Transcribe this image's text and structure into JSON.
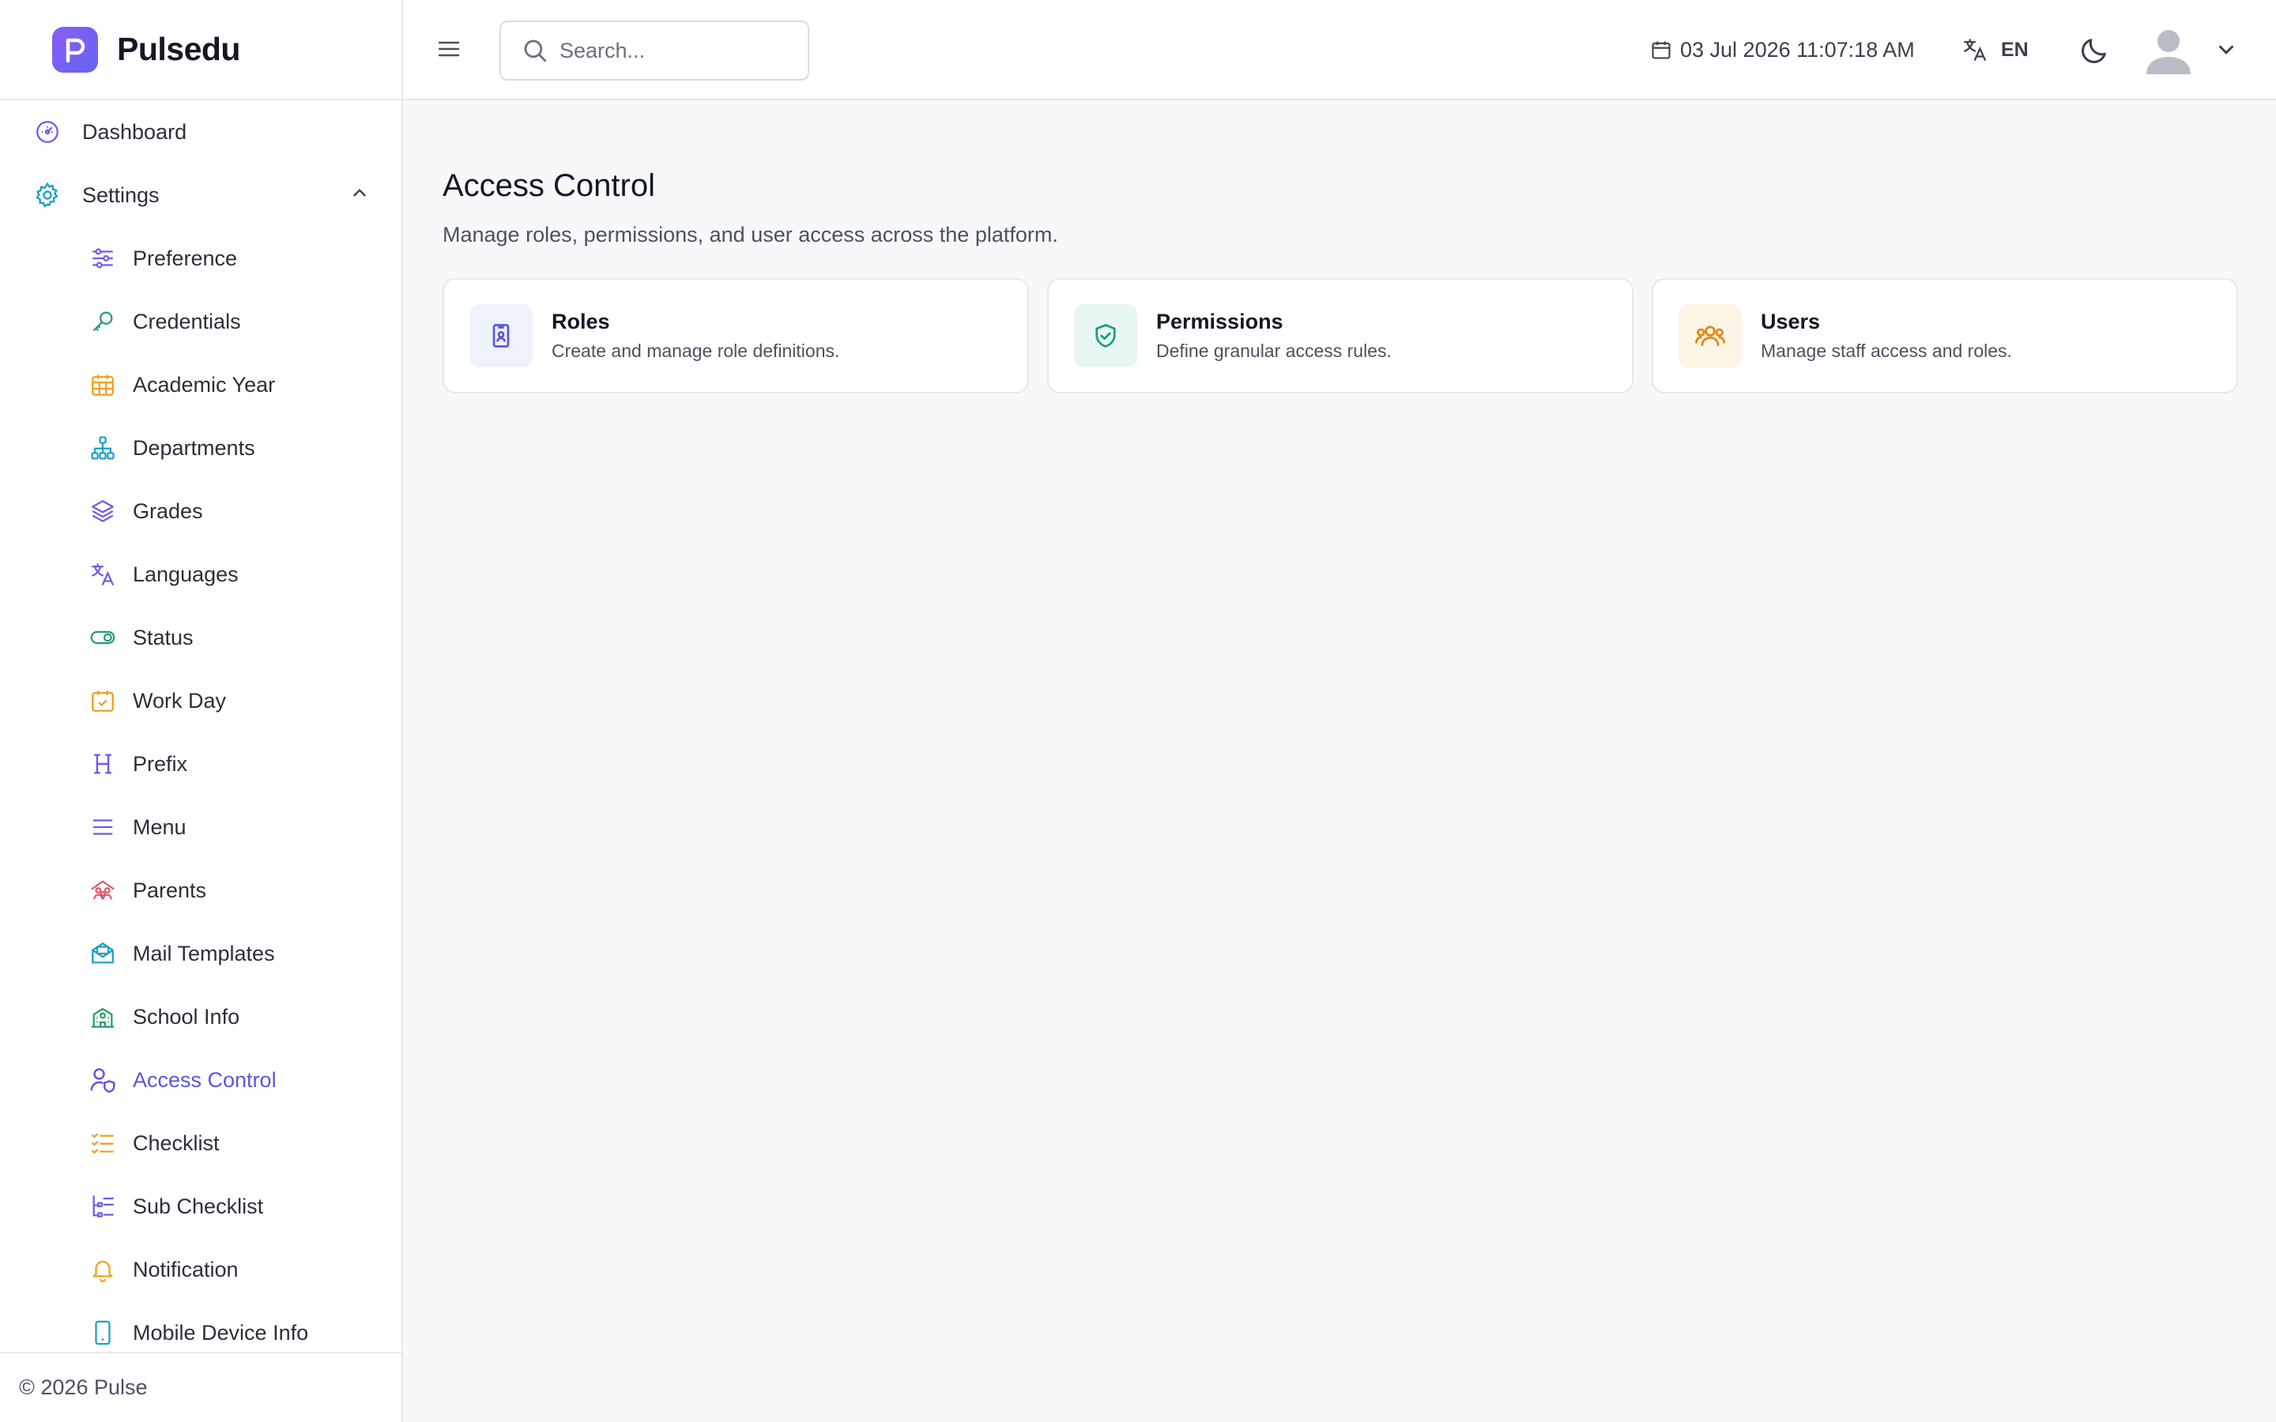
{
  "brand": {
    "name": "Pulsedu",
    "color": "#7c5cf0"
  },
  "sidebar": {
    "top_items": [
      {
        "label": "Dashboard",
        "icon": "gauge-icon",
        "color": "#6d5ce8"
      },
      {
        "label": "Settings",
        "icon": "gear-icon",
        "color": "#1ea0c8",
        "expanded": true
      }
    ],
    "sub_items": [
      {
        "label": "Preference",
        "icon": "sliders-icon",
        "color": "#6d5ce8"
      },
      {
        "label": "Credentials",
        "icon": "key-icon",
        "color": "#22a06b"
      },
      {
        "label": "Academic Year",
        "icon": "calendar-grid-icon",
        "color": "#f0a020"
      },
      {
        "label": "Departments",
        "icon": "hierarchy-icon",
        "color": "#1ea0c8"
      },
      {
        "label": "Grades",
        "icon": "layers-icon",
        "color": "#6d5ce8"
      },
      {
        "label": "Languages",
        "icon": "translate-icon",
        "color": "#6d5ce8"
      },
      {
        "label": "Status",
        "icon": "toggle-icon",
        "color": "#22a06b"
      },
      {
        "label": "Work Day",
        "icon": "calendar-check-icon",
        "color": "#f0a020"
      },
      {
        "label": "Prefix",
        "icon": "heading-icon",
        "color": "#6d5ce8"
      },
      {
        "label": "Menu",
        "icon": "menu-lines-icon",
        "color": "#6d5ce8"
      },
      {
        "label": "Parents",
        "icon": "family-icon",
        "color": "#e0506a"
      },
      {
        "label": "Mail Templates",
        "icon": "mail-template-icon",
        "color": "#1ea0c8"
      },
      {
        "label": "School Info",
        "icon": "school-icon",
        "color": "#22a06b"
      },
      {
        "label": "Access Control",
        "icon": "user-shield-icon",
        "color": "#5b55e0",
        "active": true
      },
      {
        "label": "Checklist",
        "icon": "checklist-icon",
        "color": "#f0a020"
      },
      {
        "label": "Sub Checklist",
        "icon": "sub-checklist-icon",
        "color": "#6d5ce8"
      },
      {
        "label": "Notification",
        "icon": "bell-icon",
        "color": "#f0a020"
      },
      {
        "label": "Mobile Device Info",
        "icon": "mobile-icon",
        "color": "#1ea0c8"
      }
    ],
    "footer": "© 2026 Pulse"
  },
  "header": {
    "search_placeholder": "Search...",
    "datetime": "03 Jul 2026 11:07:18 AM",
    "language": "EN"
  },
  "main": {
    "title": "Access Control",
    "subtitle": "Manage roles, permissions, and user access across the platform.",
    "cards": [
      {
        "title": "Roles",
        "desc": "Create and manage role definitions.",
        "icon": "id-badge-icon",
        "color": "#5b55e0",
        "tile_bg": "#eef2fb"
      },
      {
        "title": "Permissions",
        "desc": "Define granular access rules.",
        "icon": "shield-check-icon",
        "color": "#14a07a",
        "tile_bg": "#e8f6f3"
      },
      {
        "title": "Users",
        "desc": "Manage staff access and roles.",
        "icon": "users-icon",
        "color": "#e08a1a",
        "tile_bg": "#fdf5e6"
      }
    ]
  }
}
